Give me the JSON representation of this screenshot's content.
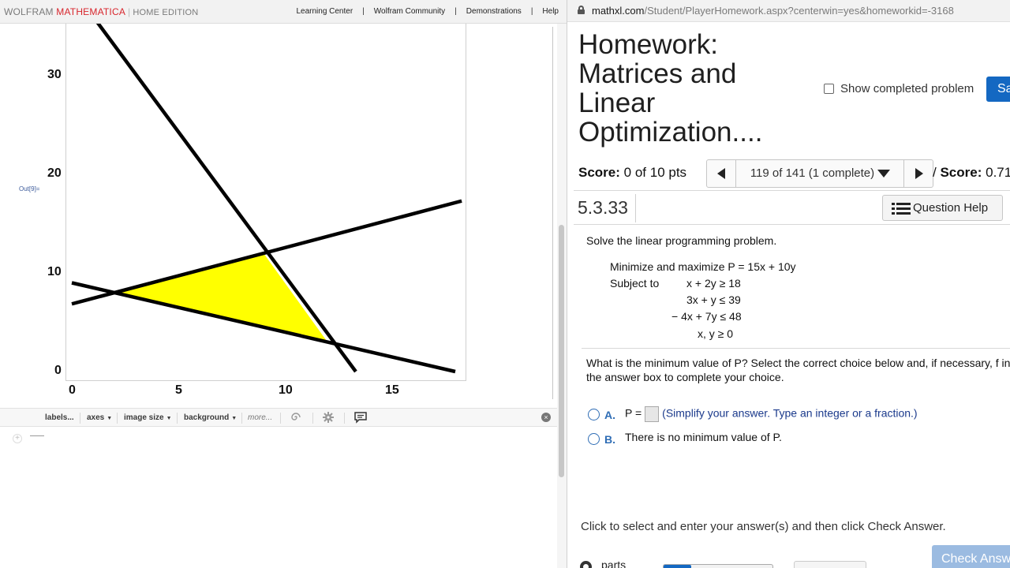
{
  "mathematica": {
    "brand_wolfram": "WOLFRAM",
    "brand_mathematica": "MATHEMATICA",
    "brand_edition": "HOME EDITION",
    "nav": [
      "Learning Center",
      "Wolfram Community",
      "Demonstrations",
      "Help"
    ],
    "out_label": "Out[9]=",
    "toolbar": {
      "labels": "labels...",
      "axes": "axes",
      "image_size": "image size",
      "background": "background",
      "more": "more..."
    },
    "colors": {
      "feasible_region": "#ffff00",
      "brand_red": "#d8262d"
    }
  },
  "chart_data": {
    "type": "line",
    "title": "",
    "xlabel": "",
    "ylabel": "",
    "xlim": [
      -0.5,
      18.5
    ],
    "ylim": [
      -0.7,
      34.5
    ],
    "x_ticks": [
      "0",
      "5",
      "10",
      "15"
    ],
    "y_ticks": [
      "0",
      "10",
      "20",
      "30"
    ],
    "series": [
      {
        "equation": "x + 2y = 18",
        "x": [
          0,
          18
        ],
        "y": [
          9,
          0
        ]
      },
      {
        "equation": "3x + y = 39",
        "x": [
          1.17,
          13.33
        ],
        "y": [
          35.5,
          0
        ]
      },
      {
        "equation": "-4x + 7y = 48",
        "x": [
          0,
          18.3
        ],
        "y": [
          6.86,
          17.3
        ]
      }
    ],
    "feasible_region": {
      "x": [
        2,
        9,
        12
      ],
      "y": [
        8,
        12,
        3
      ]
    }
  },
  "mathxl": {
    "url_host": "mathxl.com",
    "url_path": "/Student/PlayerHomework.aspx?centerwin=yes&homeworkid=-3168",
    "title": "Homework: Matrices and Linear Optimization....",
    "show_completed_label": "Show completed problem",
    "save_label": "Sa",
    "score_label": "Score:",
    "score_value": "0 of 10 pts",
    "question_selector": "119 of 141 (1 complete)",
    "hw_score_prefix": "/",
    "hw_score_label": "Score:",
    "hw_score_value": "0.71",
    "question_number": "5.3.33",
    "help_label": "Question Help",
    "prompt": "Solve the linear programming problem.",
    "objective": "Minimize and maximize P = 15x + 10y",
    "subject_to": "Subject to",
    "constraints": [
      "x + 2y  ≥  18",
      "3x + y  ≤  39",
      "− 4x + 7y  ≤  48",
      "x, y  ≥  0"
    ],
    "question": "What is the minimum value of P? Select the correct choice below and, if necessary, f in the answer box to complete your choice.",
    "option_a_letter": "A.",
    "option_a_prefix": "P =",
    "option_a_hint": "(Simplify your answer. Type an integer or a fraction.)",
    "option_b_letter": "B.",
    "option_b_text": "There is no minimum value of P.",
    "bottom_note": "Click to select and enter your answer(s) and then click Check Answer.",
    "check_label": "Check Answ",
    "parts_label": "parts",
    "parts_progress": 0.25
  }
}
